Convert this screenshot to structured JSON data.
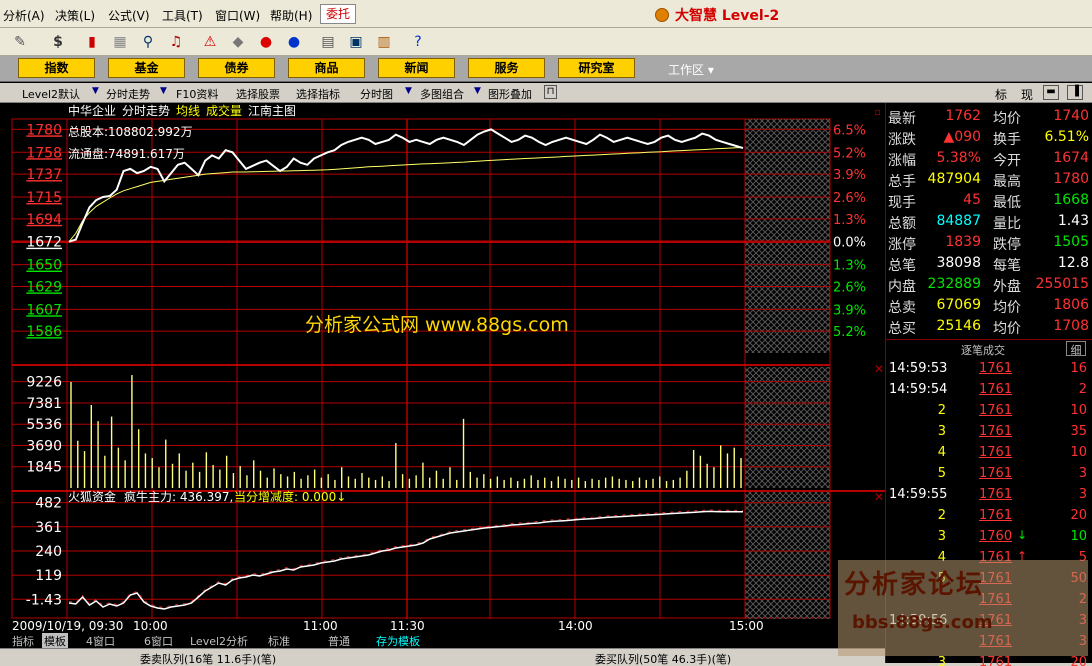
{
  "menu": {
    "items": [
      "分析(A)",
      "决策(L)",
      "公式(V)",
      "工具(T)",
      "窗口(W)",
      "帮助(H)"
    ],
    "trade": "委托",
    "brand": "大智慧 Level-2"
  },
  "toolbar": {
    "icons": [
      "ruler-icon",
      "dollar-icon",
      "color-bars-icon",
      "grid-icon",
      "binoculars-icon",
      "bell-icon",
      "alert-icon",
      "diamond-icon",
      "red-circle-icon",
      "blue-circle-icon",
      "clipboard-icon",
      "window-icon",
      "books-icon",
      "help-cursor-icon"
    ]
  },
  "nav": {
    "buttons": [
      "指数",
      "基金",
      "债券",
      "商品",
      "新闻",
      "服务",
      "研究室"
    ],
    "workspace": "工作区"
  },
  "subbar": {
    "items": [
      "Level2默认",
      "分时走势",
      "F10资料",
      "选择股票",
      "选择指标",
      "分时图",
      "多图组合",
      "图形叠加"
    ],
    "right_tabs": [
      "标",
      "现"
    ]
  },
  "chart_header": {
    "stock_name": "中华企业",
    "view": "分时走势",
    "avg_label": "均线",
    "vol_label": "成交量",
    "index_label": "江南主图",
    "total_shares": "总股本:108802.992万",
    "float_shares": "流通盘:74891.617万",
    "watermark": "分析家公式网 www.88gs.com"
  },
  "indicator": {
    "title": "火狐资金",
    "main_force": "疯牛主力: 436.397,",
    "delta": "当分增减度: 0.000↓"
  },
  "chart_data": {
    "type": "line",
    "title": "",
    "date_time": "2009/10/19, 09:30",
    "x_ticks": [
      "10:00",
      "11:00",
      "11:30",
      "14:00",
      "15:00"
    ],
    "price_ticks_red": [
      "1780",
      "1758",
      "1737",
      "1715",
      "1694"
    ],
    "price_base": "1672",
    "price_ticks_green": [
      "1650",
      "1629",
      "1607",
      "1586"
    ],
    "pct_ticks_red": [
      "6.5%",
      "5.2%",
      "3.9%",
      "2.6%",
      "1.3%"
    ],
    "pct_base": "0.0%",
    "pct_ticks_green": [
      "1.3%",
      "2.6%",
      "3.9%",
      "5.2%"
    ],
    "volume_ticks": [
      "9226",
      "7381",
      "5536",
      "3690",
      "1845"
    ],
    "indicator_ticks": [
      "482",
      "361",
      "240",
      "119",
      "-1.43"
    ],
    "ylim_price": [
      1565,
      1790
    ],
    "ylim_volume": [
      0,
      10500
    ],
    "ylim_indicator": [
      -80,
      500
    ],
    "price_series": [
      1672,
      1674,
      1690,
      1705,
      1712,
      1715,
      1716,
      1722,
      1740,
      1742,
      1738,
      1740,
      1744,
      1742,
      1730,
      1738,
      1746,
      1748,
      1742,
      1736,
      1750,
      1755,
      1752,
      1760,
      1758,
      1750,
      1742,
      1745,
      1748,
      1750,
      1745,
      1740,
      1744,
      1752,
      1748,
      1746,
      1752,
      1755,
      1758,
      1760,
      1765,
      1768,
      1770,
      1772,
      1770,
      1766,
      1768,
      1770,
      1775,
      1772,
      1768,
      1770,
      1768,
      1766,
      1770,
      1772,
      1770,
      1768,
      1765,
      1770,
      1775,
      1778,
      1780,
      1776,
      1772,
      1768,
      1770,
      1774,
      1772,
      1768,
      1765,
      1768,
      1770,
      1772,
      1770,
      1768,
      1766,
      1770,
      1775,
      1772,
      1768,
      1770,
      1772,
      1770,
      1768,
      1766,
      1768,
      1772,
      1774,
      1770,
      1768,
      1770,
      1772,
      1776,
      1774,
      1770,
      1768,
      1766,
      1764,
      1762
    ],
    "avg_series": [
      1672,
      1680,
      1692,
      1700,
      1706,
      1710,
      1714,
      1718,
      1721,
      1723,
      1725,
      1727,
      1729,
      1730,
      1731,
      1732,
      1733,
      1734,
      1735,
      1736,
      1737,
      1737.5,
      1738,
      1738.5,
      1739,
      1739,
      1739,
      1739.2,
      1739.4,
      1739.6,
      1739.8,
      1740,
      1740,
      1740.2,
      1740.4,
      1740.6,
      1740.8,
      1741,
      1741.2,
      1741.5,
      1742,
      1742.5,
      1743,
      1743.5,
      1744,
      1744.3,
      1744.6,
      1745,
      1745.4,
      1745.8,
      1746.2,
      1746.5,
      1746.8,
      1747,
      1747.3,
      1747.6,
      1748,
      1748.3,
      1748.6,
      1749,
      1749.4,
      1749.8,
      1750.2,
      1750.6,
      1751,
      1751.3,
      1751.6,
      1752,
      1752.3,
      1752.6,
      1753,
      1753.3,
      1753.6,
      1754,
      1754.3,
      1754.6,
      1755,
      1755.3,
      1755.6,
      1756,
      1756.3,
      1756.6,
      1757,
      1757.3,
      1757.6,
      1758,
      1758.3,
      1758.6,
      1759,
      1759.3,
      1759.6,
      1760,
      1760.3,
      1760.6,
      1761,
      1761.3,
      1761.6,
      1762,
      1762.3,
      1762.6
    ],
    "volume_series": [
      9200,
      4100,
      3200,
      7200,
      5800,
      2800,
      6200,
      3500,
      2400,
      9800,
      5100,
      3000,
      2600,
      1800,
      4200,
      2100,
      3000,
      1500,
      2200,
      1400,
      3100,
      2000,
      1600,
      2800,
      1300,
      1900,
      1100,
      2400,
      1500,
      900,
      1700,
      1200,
      1000,
      1400,
      800,
      1100,
      1600,
      900,
      1200,
      700,
      1800,
      1000,
      800,
      1300,
      900,
      700,
      1000,
      600,
      3900,
      1200,
      800,
      1100,
      2200,
      900,
      1500,
      800,
      1800,
      700,
      6000,
      1400,
      900,
      1200,
      800,
      1000,
      700,
      900,
      600,
      800,
      1100,
      700,
      900,
      600,
      1000,
      800,
      700,
      900,
      600,
      800,
      700,
      900,
      1000,
      800,
      700,
      600,
      900,
      700,
      800,
      1000,
      600,
      700,
      900,
      1500,
      3300,
      2800,
      2100,
      1800,
      3700,
      3000,
      3500,
      2600
    ],
    "indicator_series": [
      -20,
      -25,
      10,
      -30,
      -10,
      -40,
      -25,
      -35,
      -20,
      20,
      30,
      -15,
      -35,
      -45,
      -50,
      -40,
      -35,
      -30,
      -20,
      10,
      40,
      60,
      80,
      70,
      95,
      105,
      110,
      120,
      115,
      125,
      135,
      140,
      150,
      145,
      160,
      165,
      170,
      180,
      185,
      190,
      200,
      205,
      210,
      215,
      220,
      230,
      240,
      245,
      255,
      260,
      265,
      270,
      280,
      300,
      310,
      320,
      330,
      335,
      340,
      345,
      350,
      355,
      358,
      362,
      365,
      370,
      372,
      375,
      378,
      380,
      385,
      388,
      390,
      392,
      395,
      398,
      400,
      402,
      405,
      408,
      410,
      412,
      414,
      416,
      418,
      420,
      422,
      424,
      426,
      428,
      430,
      432,
      434,
      436,
      438,
      437,
      436,
      437,
      436,
      436
    ]
  },
  "quote": {
    "rows": [
      {
        "l1": "最新",
        "v1": "1762",
        "c1": "red",
        "l2": "均价",
        "v2": "1740",
        "c2": "red"
      },
      {
        "l1": "涨跌",
        "v1": "▲090",
        "c1": "red",
        "l2": "换手",
        "v2": "6.51%",
        "c2": "yellow"
      },
      {
        "l1": "涨幅",
        "v1": "5.38%",
        "c1": "red",
        "l2": "今开",
        "v2": "1674",
        "c2": "red"
      },
      {
        "l1": "总手",
        "v1": "487904",
        "c1": "yellow",
        "l2": "最高",
        "v2": "1780",
        "c2": "red"
      },
      {
        "l1": "现手",
        "v1": "45",
        "c1": "red",
        "l2": "最低",
        "v2": "1668",
        "c2": "green"
      },
      {
        "l1": "总额",
        "v1": "84887",
        "c1": "cyan",
        "l2": "量比",
        "v2": "1.43",
        "c2": "white"
      },
      {
        "l1": "涨停",
        "v1": "1839",
        "c1": "red",
        "l2": "跌停",
        "v2": "1505",
        "c2": "green"
      },
      {
        "l1": "总笔",
        "v1": "38098",
        "c1": "white",
        "l2": "每笔",
        "v2": "12.8",
        "c2": "white"
      },
      {
        "l1": "内盘",
        "v1": "232889",
        "c1": "green",
        "l2": "外盘",
        "v2": "255015",
        "c2": "red"
      },
      {
        "l1": "总卖",
        "v1": "67069",
        "c1": "yellow",
        "l2": "均价",
        "v2": "1806",
        "c2": "red"
      },
      {
        "l1": "总买",
        "v1": "25146",
        "c1": "yellow",
        "l2": "均价",
        "v2": "1708",
        "c2": "red"
      }
    ],
    "ticks_title": "逐笔成交",
    "ticks_tab": "细",
    "ticks": [
      {
        "t": "14:59:53",
        "n": "",
        "p": "1761",
        "a": "",
        "ac": "",
        "v": "16",
        "vc": "red"
      },
      {
        "t": "14:59:54",
        "n": "",
        "p": "1761",
        "a": "",
        "ac": "",
        "v": "2",
        "vc": "red"
      },
      {
        "t": "",
        "n": "2",
        "p": "1761",
        "a": "",
        "ac": "",
        "v": "10",
        "vc": "red"
      },
      {
        "t": "",
        "n": "3",
        "p": "1761",
        "a": "",
        "ac": "",
        "v": "35",
        "vc": "red"
      },
      {
        "t": "",
        "n": "4",
        "p": "1761",
        "a": "",
        "ac": "",
        "v": "10",
        "vc": "red"
      },
      {
        "t": "",
        "n": "5",
        "p": "1761",
        "a": "",
        "ac": "",
        "v": "3",
        "vc": "red"
      },
      {
        "t": "14:59:55",
        "n": "",
        "p": "1761",
        "a": "",
        "ac": "",
        "v": "3",
        "vc": "red"
      },
      {
        "t": "",
        "n": "2",
        "p": "1761",
        "a": "",
        "ac": "",
        "v": "20",
        "vc": "red"
      },
      {
        "t": "",
        "n": "3",
        "p": "1760",
        "a": "↓",
        "ac": "green",
        "v": "10",
        "vc": "green"
      },
      {
        "t": "",
        "n": "4",
        "p": "1761",
        "a": "↑",
        "ac": "red",
        "v": "5",
        "vc": "red"
      },
      {
        "t": "",
        "n": "5",
        "p": "1761",
        "a": "",
        "ac": "",
        "v": "50",
        "vc": "red"
      },
      {
        "t": "",
        "n": "",
        "p": "1761",
        "a": "",
        "ac": "",
        "v": "2",
        "vc": "red"
      },
      {
        "t": "14:59:56",
        "n": "",
        "p": "1761",
        "a": "",
        "ac": "",
        "v": "3",
        "vc": "red"
      },
      {
        "t": "",
        "n": "",
        "p": "1761",
        "a": "",
        "ac": "",
        "v": "3",
        "vc": "red"
      },
      {
        "t": "",
        "n": "3",
        "p": "1761",
        "a": "",
        "ac": "",
        "v": "20",
        "vc": "red"
      }
    ]
  },
  "bottom_tabs": [
    "指标",
    "模板",
    "4窗口",
    "6窗口",
    "Level2分析",
    "标准",
    "普通",
    "存为模板"
  ],
  "status": {
    "left": "委卖队列(16笔 11.6手)(笔)",
    "right": "委买队列(50笔 46.3手)(笔)"
  },
  "watermark2": {
    "title": "分析家论坛",
    "url": "bbs.88gs.com"
  },
  "colors": {
    "up": "#ff3232",
    "down": "#00e600",
    "grid": "#b40000",
    "price_line": "#ffffff",
    "avg_line": "#ffff66",
    "volume": "#ffff80",
    "nav_button": "#ffd000"
  }
}
